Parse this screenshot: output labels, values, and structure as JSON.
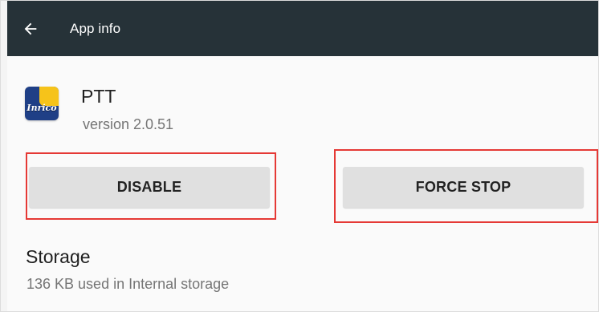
{
  "appbar": {
    "title": "App info",
    "back_icon": "arrow-left-icon"
  },
  "app": {
    "name": "PTT",
    "version": "version 2.0.51",
    "icon_label": "Inrico"
  },
  "actions": {
    "disable_label": "DISABLE",
    "force_stop_label": "FORCE STOP"
  },
  "storage": {
    "title": "Storage",
    "summary": "136 KB used in Internal storage"
  },
  "colors": {
    "appbar": "#263238",
    "button": "#e0e0e0",
    "highlight": "#e53935"
  }
}
